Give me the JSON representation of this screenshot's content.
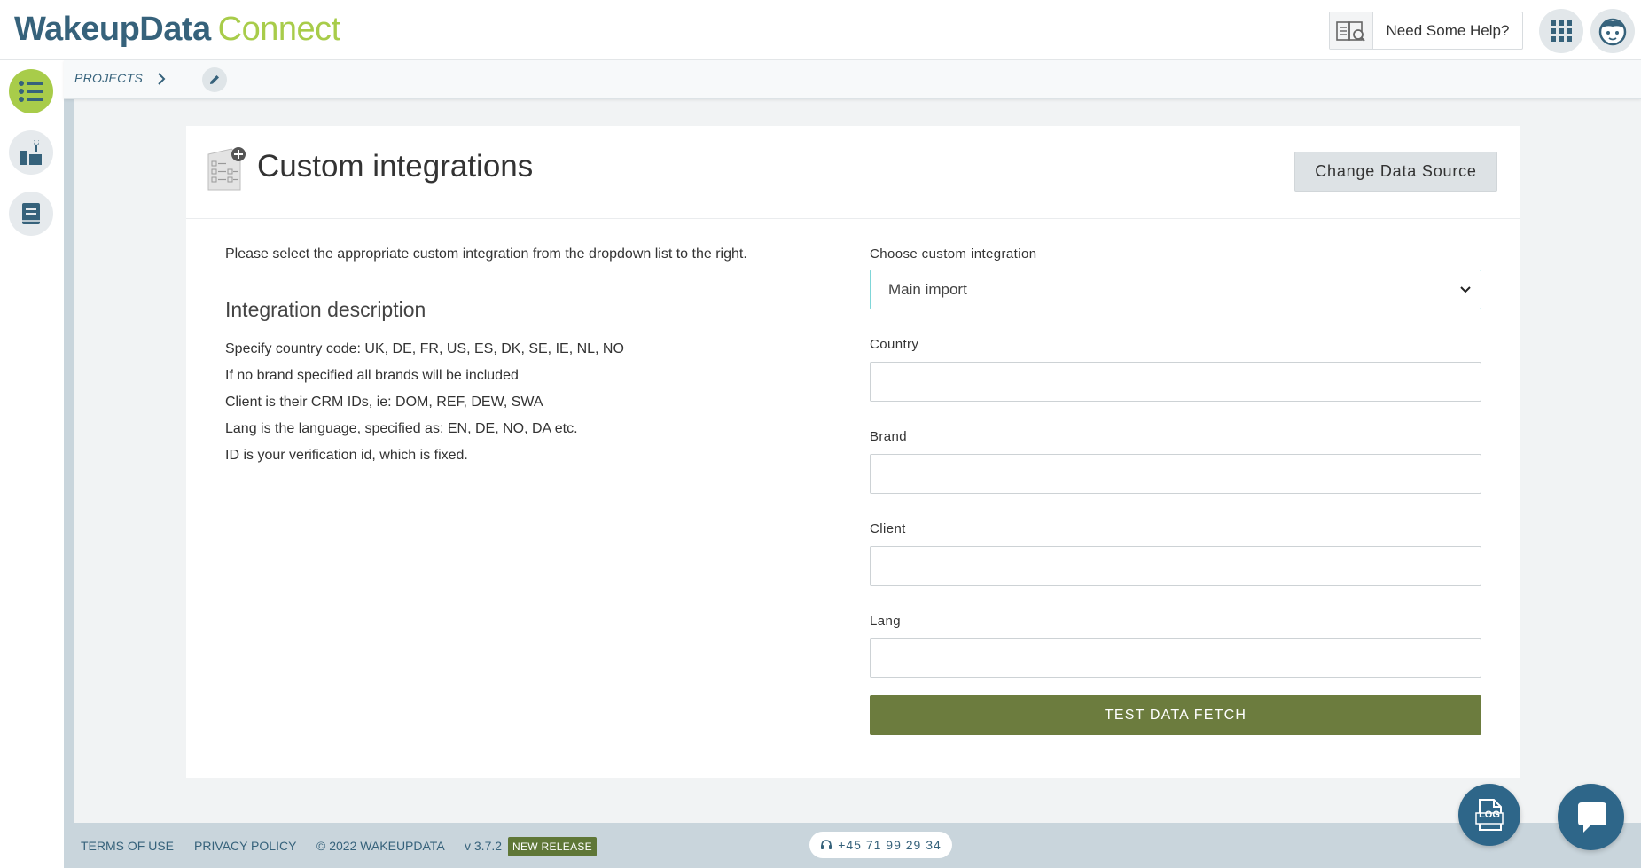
{
  "header": {
    "logo_part1": "WakeupData",
    "logo_part2": "Connect",
    "help_label": "Need Some Help?"
  },
  "breadcrumb": {
    "projects_label": "PROJECTS"
  },
  "card": {
    "title": "Custom integrations",
    "change_button": "Change Data Source",
    "intro": "Please select the appropriate custom integration from the dropdown list to the right.",
    "description_title": "Integration description",
    "description_lines": [
      "Specify country code: UK, DE, FR, US, ES, DK, SE, IE, NL, NO",
      "If no brand specified all brands will be included",
      "Client is their CRM IDs, ie: DOM, REF, DEW, SWA",
      "Lang is the language, specified as: EN, DE, NO, DA etc.",
      "ID is your verification id, which is fixed."
    ]
  },
  "form": {
    "integration_label": "Choose custom integration",
    "integration_selected": "Main import",
    "country_label": "Country",
    "country_value": "",
    "brand_label": "Brand",
    "brand_value": "",
    "client_label": "Client",
    "client_value": "",
    "lang_label": "Lang",
    "lang_value": "",
    "fetch_button": "TEST DATA FETCH"
  },
  "footer": {
    "terms": "TERMS OF USE",
    "privacy": "PRIVACY POLICY",
    "copyright": "© 2022 WAKEUPDATA",
    "version": "v 3.7.2",
    "release_badge": "NEW RELEASE",
    "phone": "+45 71 99 29 34"
  },
  "float": {
    "log_label": "LOG"
  },
  "colors": {
    "brand_blue": "#36627b",
    "brand_green": "#a8cc4a",
    "fetch_button": "#6c7c3e",
    "select_focus": "#7fd6d8",
    "float_button": "#2e6689"
  },
  "icons": {
    "help": "book-search-icon",
    "apps": "grid-icon",
    "profile": "avatar-icon",
    "projects": "list-icon",
    "tools": "tools-icon",
    "docs": "book-icon",
    "edit": "pencil-icon",
    "chat": "chat-icon",
    "log": "log-icon",
    "phone": "headset-icon"
  }
}
